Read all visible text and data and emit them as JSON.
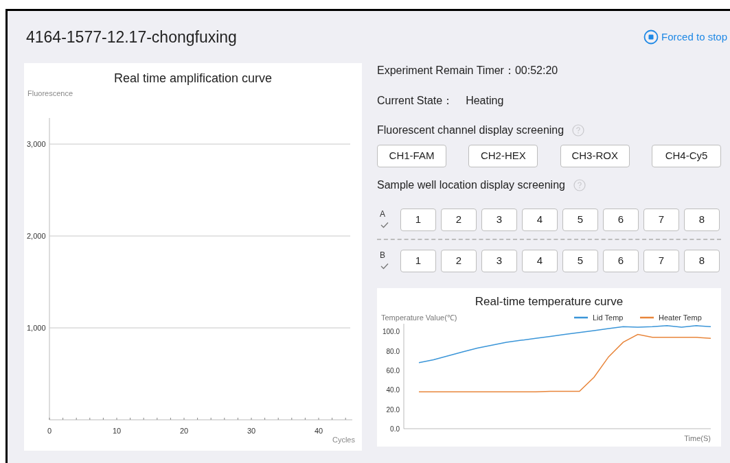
{
  "title": "4164-1577-12.17-chongfuxing",
  "stop_button": {
    "label": "Forced to stop"
  },
  "amplification": {
    "chart_data": {
      "type": "line",
      "title": "Real time amplification curve",
      "ylabel": "Fluorescence",
      "xlabel": "Cycles",
      "grid": true,
      "xlim": [
        0,
        45
      ],
      "ylim": [
        0,
        3284
      ],
      "xticks": [
        0,
        10,
        20,
        30,
        40
      ],
      "yticks": [
        {
          "value": 1000,
          "label": "1,000"
        },
        {
          "value": 2000,
          "label": "2,000"
        },
        {
          "value": 3000,
          "label": "3,000"
        }
      ]
    }
  },
  "timer": {
    "label": "Experiment Remain Timer：",
    "value": "00:52:20"
  },
  "state": {
    "label": "Current State：",
    "value": "Heating"
  },
  "channel_section": {
    "label": "Fluorescent channel display screening"
  },
  "channels": [
    "CH1-FAM",
    "CH2-HEX",
    "CH3-ROX",
    "CH4-Cy5"
  ],
  "well_section": {
    "label": "Sample well location display screening"
  },
  "well_rows": [
    {
      "label": "A",
      "checked": true,
      "wells": [
        "1",
        "2",
        "3",
        "4",
        "5",
        "6",
        "7",
        "8"
      ]
    },
    {
      "label": "B",
      "checked": true,
      "wells": [
        "1",
        "2",
        "3",
        "4",
        "5",
        "6",
        "7",
        "8"
      ]
    }
  ],
  "temperature": {
    "chart_data": {
      "type": "line",
      "title": "Real-time temperature curve",
      "ylabel": "Temperature Value(℃)",
      "xlabel": "Time(S)",
      "legend": "top-right",
      "ylim": [
        0,
        108
      ],
      "yticks": [
        {
          "value": 0,
          "label": "0.0"
        },
        {
          "value": 20,
          "label": "20.0"
        },
        {
          "value": 40,
          "label": "40.0"
        },
        {
          "value": 60,
          "label": "60.0"
        },
        {
          "value": 80,
          "label": "80.0"
        },
        {
          "value": 100,
          "label": "100.0"
        }
      ],
      "series": [
        {
          "name": "Lid Temp",
          "color": "#3a95d8",
          "values": [
            68,
            71,
            75,
            79,
            83,
            86,
            89,
            91,
            93,
            95,
            97,
            99,
            101,
            103,
            105,
            104.5,
            105,
            106,
            104.5,
            106,
            105
          ]
        },
        {
          "name": "Heater Temp",
          "color": "#e8853a",
          "values": [
            38,
            38,
            38,
            38,
            38,
            38,
            38,
            38,
            38,
            38.5,
            38.5,
            38.5,
            53,
            74,
            89,
            97,
            94,
            94,
            94,
            94,
            93
          ]
        }
      ]
    }
  }
}
